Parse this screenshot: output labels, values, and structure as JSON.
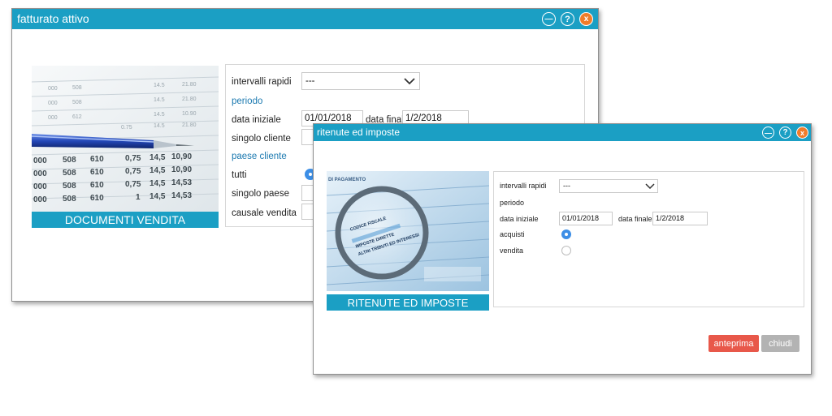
{
  "main_window": {
    "title": "fatturato attivo",
    "image_caption": "DOCUMENTI VENDITA",
    "form": {
      "intervalli_rapidi_label": "intervalli rapidi",
      "intervalli_rapidi_value": "---",
      "periodo_label": "periodo",
      "data_iniziale_label": "data iniziale",
      "data_iniziale_value": "01/01/2018",
      "data_finale_label": "data finale",
      "data_finale_value": "1/2/2018",
      "singolo_cliente_label": "singolo cliente",
      "paese_cliente_label": "paese cliente",
      "tutti_label": "tutti",
      "singolo_paese_label": "singolo paese",
      "causale_vendita_label": "causale vendita"
    },
    "spreadsheet_rows": [
      [
        "000",
        "508",
        "610",
        "0,75",
        "14,5",
        "10,90"
      ],
      [
        "000",
        "508",
        "610",
        "0,75",
        "14,5",
        "10,90"
      ],
      [
        "000",
        "508",
        "610",
        "0,75",
        "14,5",
        "14,53"
      ],
      [
        "000",
        "508",
        "610",
        "1",
        "14,5",
        "14,53"
      ]
    ]
  },
  "dialog": {
    "title": "ritenute ed imposte",
    "image_caption": "RITENUTE ED IMPOSTE",
    "document_text": [
      "DI PAGAMENTO",
      "CODICE FISCALE",
      "IMPOSTE DIRETTE",
      "ALTRI TRIBUTI ED INTERESSI"
    ],
    "form": {
      "intervalli_rapidi_label": "intervalli rapidi",
      "intervalli_rapidi_value": "---",
      "periodo_label": "periodo",
      "data_iniziale_label": "data iniziale",
      "data_iniziale_value": "01/01/2018",
      "data_finale_label": "data finale",
      "data_finale_value": "1/2/2018",
      "acquisti_label": "acquisti",
      "vendita_label": "vendita"
    },
    "buttons": {
      "anteprima": "anteprima",
      "chiudi": "chiudi"
    }
  },
  "colors": {
    "accent": "#1b9fc4",
    "close": "#f07c2a",
    "primary_button": "#e8584a",
    "secondary_button": "#b3b3b3",
    "radio_on": "#3c8ee6"
  }
}
